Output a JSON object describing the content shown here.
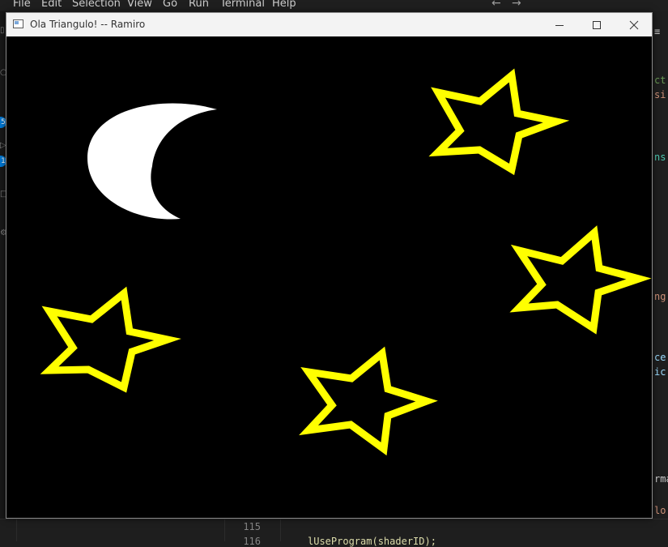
{
  "ide": {
    "menu": [
      "File",
      "Edit",
      "Selection",
      "View",
      "Go",
      "Run",
      "Terminal",
      "Help"
    ],
    "badges": [
      "5",
      "1"
    ],
    "right_fragments": [
      {
        "text": "≡",
        "color": "#cccccc"
      },
      {
        "text": "ct",
        "color": "#6a9955"
      },
      {
        "text": "si",
        "color": "#ce9178"
      },
      {
        "text": "ns",
        "color": "#4ec9b0"
      },
      {
        "text": "ng",
        "color": "#ce9178"
      },
      {
        "text": "ce",
        "color": "#9cdcfe"
      },
      {
        "text": "ic",
        "color": "#9cdcfe"
      },
      {
        "text": "rma",
        "color": "#cccccc"
      },
      {
        "text": "lo",
        "color": "#ce9178"
      }
    ],
    "line_numbers": [
      "115",
      "116"
    ],
    "bottom_code": "lUseProgram(shaderID);"
  },
  "window": {
    "title": "Ola Triangulo! -- Ramiro"
  },
  "scene": {
    "background": "#000000",
    "moon_color": "#ffffff",
    "star_color": "#ffff00",
    "star_count": 4
  }
}
